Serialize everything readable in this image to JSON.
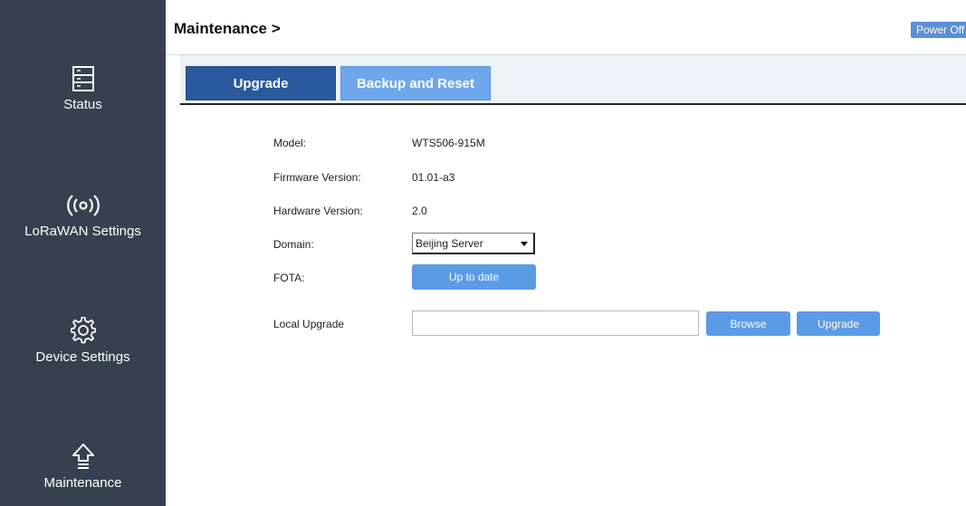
{
  "sidebar": {
    "items": [
      {
        "label": "Status",
        "icon": "server-icon"
      },
      {
        "label": "LoRaWAN Settings",
        "icon": "wireless-signal-icon"
      },
      {
        "label": "Device Settings",
        "icon": "gear-icon"
      },
      {
        "label": "Maintenance",
        "icon": "upload-arrow-icon"
      }
    ]
  },
  "header": {
    "title": "Maintenance >",
    "power_label": "Power Off"
  },
  "tabs": [
    {
      "label": "Upgrade",
      "active": true
    },
    {
      "label": "Backup and Reset",
      "active": false
    }
  ],
  "form": {
    "model_label": "Model:",
    "model_value": "WTS506-915M",
    "firmware_label": "Firmware Version:",
    "firmware_value": "01.01-a3",
    "hardware_label": "Hardware Version:",
    "hardware_value": "2.0",
    "domain_label": "Domain:",
    "domain_value": "Beijing Server",
    "fota_label": "FOTA:",
    "fota_button": "Up to date",
    "local_label": "Local Upgrade",
    "file_value": "",
    "browse_button": "Browse",
    "upgrade_button": "Upgrade"
  },
  "colors": {
    "sidebar_bg": "#36404f",
    "active_tab": "#2a5a9d",
    "inactive_tab": "#6fa7ec",
    "button": "#5b9be6"
  }
}
